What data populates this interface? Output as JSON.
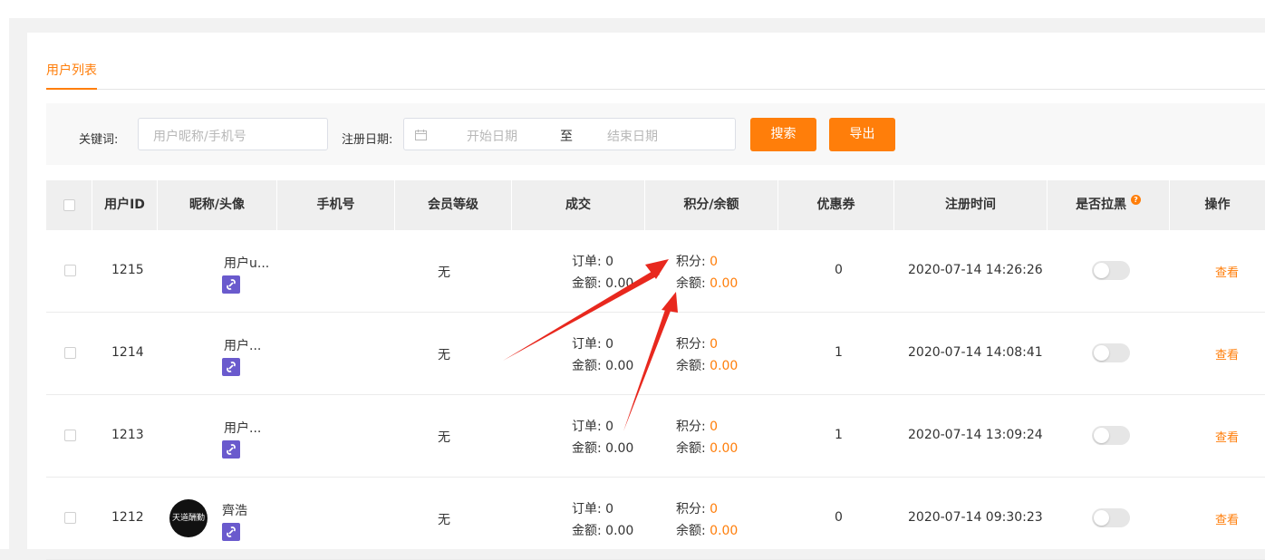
{
  "tabs": {
    "active": "用户列表"
  },
  "filter": {
    "keyword_label": "关键词:",
    "keyword_placeholder": "用户昵称/手机号",
    "date_label": "注册日期:",
    "start_placeholder": "开始日期",
    "to_text": "至",
    "end_placeholder": "结束日期",
    "search_button": "搜索",
    "export_button": "导出"
  },
  "table": {
    "headers": [
      "用户ID",
      "昵称/头像",
      "手机号",
      "会员等级",
      "成交",
      "积分/余额",
      "优惠券",
      "注册时间",
      "是否拉黑",
      "操作"
    ],
    "rows": [
      {
        "id": "1215",
        "nickname": "用户u...",
        "phone": "",
        "level": "无",
        "orders": "订单: 0",
        "amount": "金额: 0.00",
        "points_label": "积分: ",
        "points": "0",
        "balance_label": "余额: ",
        "balance": "0.00",
        "coupons": "0",
        "reg_time": "2020-07-14 14:26:26",
        "blacklisted": false,
        "action": "查看",
        "avatar": "blank"
      },
      {
        "id": "1214",
        "nickname": "用户...",
        "phone": "",
        "level": "无",
        "orders": "订单: 0",
        "amount": "金额: 0.00",
        "points_label": "积分: ",
        "points": "0",
        "balance_label": "余额: ",
        "balance": "0.00",
        "coupons": "1",
        "reg_time": "2020-07-14 14:08:41",
        "blacklisted": false,
        "action": "查看",
        "avatar": "blank"
      },
      {
        "id": "1213",
        "nickname": "用户...",
        "phone": "",
        "level": "无",
        "orders": "订单: 0",
        "amount": "金额: 0.00",
        "points_label": "积分: ",
        "points": "0",
        "balance_label": "余额: ",
        "balance": "0.00",
        "coupons": "1",
        "reg_time": "2020-07-14 13:09:24",
        "blacklisted": false,
        "action": "查看",
        "avatar": "blank"
      },
      {
        "id": "1212",
        "nickname": "齊浩",
        "phone": "",
        "level": "无",
        "orders": "订单: 0",
        "amount": "金额: 0.00",
        "points_label": "积分: ",
        "points": "0",
        "balance_label": "余额: ",
        "balance": "0.00",
        "coupons": "0",
        "reg_time": "2020-07-14 09:30:23",
        "blacklisted": false,
        "action": "查看",
        "avatar": "dark",
        "avatar_text": "天道酬勤"
      }
    ]
  },
  "colors": {
    "accent": "#ff7e0a",
    "badge": "#6a5acd",
    "arrow": "#e8281e"
  },
  "icons": {
    "calendar": "calendar-icon",
    "link": "link-icon",
    "help": "help-icon"
  }
}
